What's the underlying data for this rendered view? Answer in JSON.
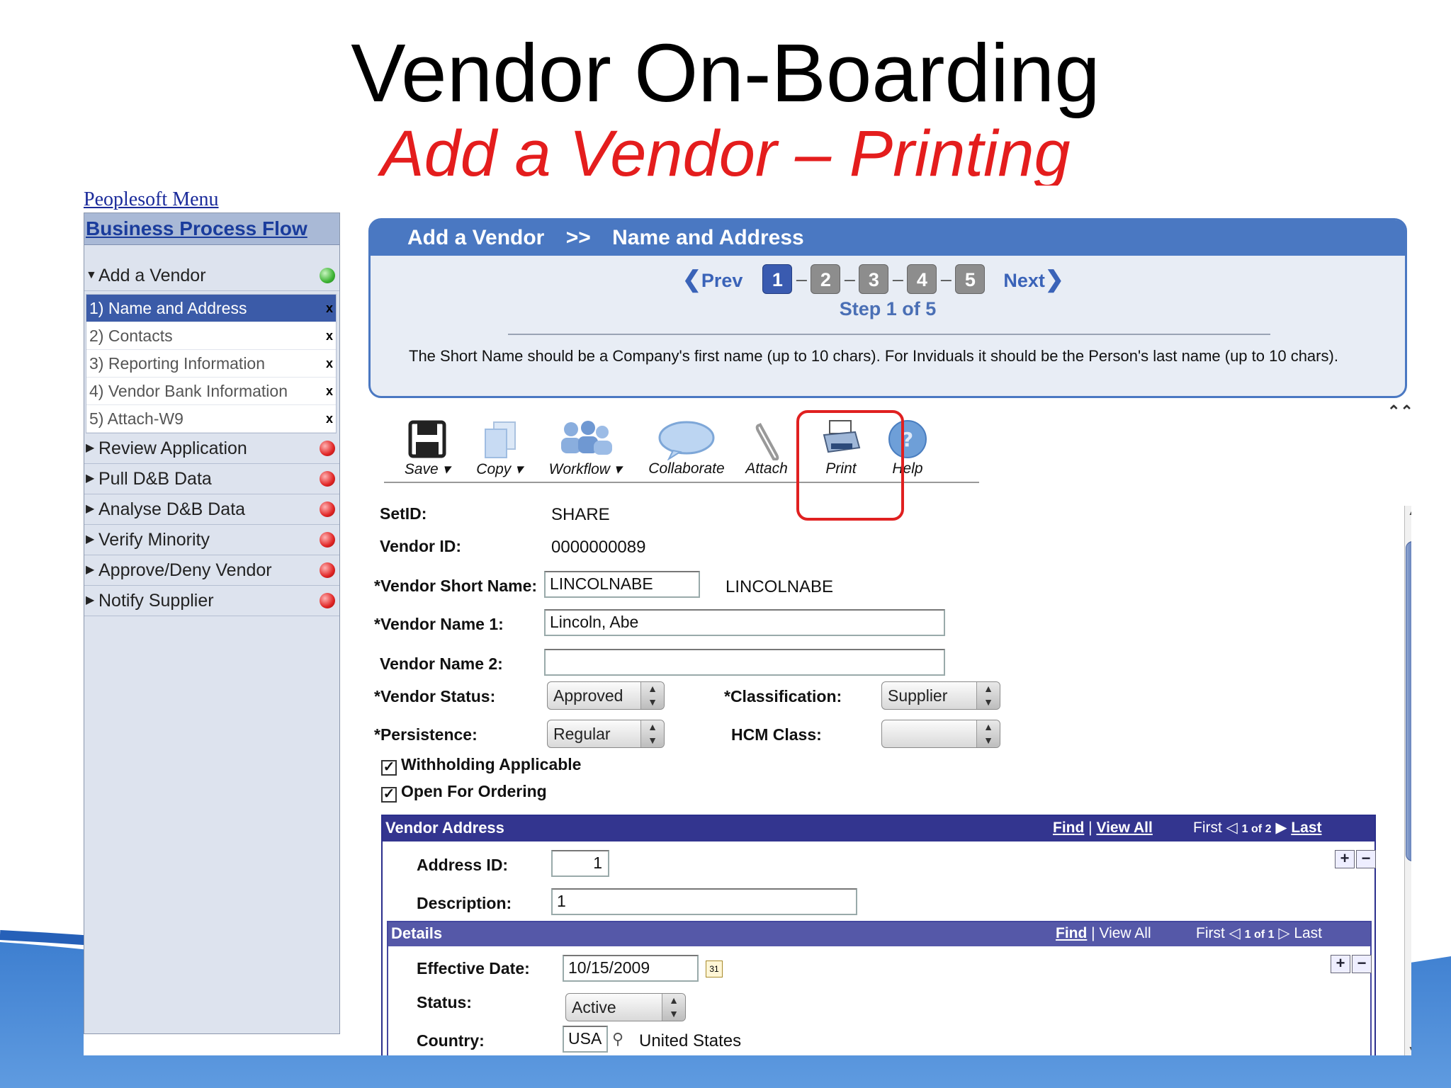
{
  "slide": {
    "title": "Vendor On-Boarding",
    "subtitle": "Add a Vendor – Printing"
  },
  "colors": {
    "accent_blue": "#4a78c2",
    "highlight_red": "#e02020",
    "subtitle_red": "#e41d1d"
  },
  "menu": {
    "peoplesoft_menu": "Peoplesoft Menu"
  },
  "sidebar": {
    "header": "Business Process Flow",
    "add_vendor": "Add a Vendor",
    "sub_items": [
      {
        "label": "1) Name and Address",
        "mark": "x"
      },
      {
        "label": "2) Contacts",
        "mark": "x"
      },
      {
        "label": "3) Reporting Information",
        "mark": "x"
      },
      {
        "label": "4) Vendor Bank Information",
        "mark": "x"
      },
      {
        "label": "5) Attach-W9",
        "mark": "x"
      }
    ],
    "steps": [
      {
        "label": "Review Application"
      },
      {
        "label": "Pull D&B Data"
      },
      {
        "label": "Analyse D&B Data"
      },
      {
        "label": "Verify Minority"
      },
      {
        "label": "Approve/Deny Vendor"
      },
      {
        "label": "Notify Supplier"
      }
    ]
  },
  "panel": {
    "crumb1": "Add a Vendor",
    "crumb_sep": ">>",
    "crumb2": "Name and Address",
    "prev": "Prev",
    "next": "Next",
    "steps": [
      "1",
      "2",
      "3",
      "4",
      "5"
    ],
    "step_sep": "–",
    "step_label": "Step 1 of 5",
    "instructions": "The Short Name should be a Company's first name (up to 10 chars). For Inviduals it should be the Person's last name (up to 10 chars)."
  },
  "toolbar": {
    "save": "Save",
    "copy": "Copy",
    "workflow": "Workflow",
    "collaborate": "Collaborate",
    "attach": "Attach",
    "print": "Print",
    "help": "Help"
  },
  "form": {
    "setid_label": "SetID:",
    "setid_value": "SHARE",
    "vendor_id_label": "Vendor ID:",
    "vendor_id_value": "0000000089",
    "short_name_label": "*Vendor Short Name:",
    "short_name_value": "LINCOLNABE",
    "short_name_display": "LINCOLNABE",
    "name1_label": "*Vendor Name 1:",
    "name1_value": "Lincoln, Abe",
    "name2_label": "Vendor Name 2:",
    "name2_value": "",
    "status_label": "*Vendor Status:",
    "status_value": "Approved",
    "classification_label": "*Classification:",
    "classification_value": "Supplier",
    "persistence_label": "*Persistence:",
    "persistence_value": "Regular",
    "hcm_label": "HCM Class:",
    "hcm_value": "",
    "withholding": "Withholding Applicable",
    "open_ordering": "Open For Ordering"
  },
  "address": {
    "header": "Vendor Address",
    "find": "Find",
    "view_all": "View All",
    "first": "First",
    "count": "1 of 2",
    "last": "Last",
    "address_id_label": "Address ID:",
    "address_id_value": "1",
    "description_label": "Description:",
    "description_value": "1"
  },
  "details": {
    "header": "Details",
    "find": "Find",
    "view_all": "View All",
    "first": "First",
    "count": "1 of 1",
    "last": "Last",
    "effective_date_label": "Effective Date:",
    "effective_date_value": "10/15/2009",
    "status_label": "Status:",
    "status_value": "Active",
    "country_label": "Country:",
    "country_value": "USA",
    "country_name": "United States"
  }
}
